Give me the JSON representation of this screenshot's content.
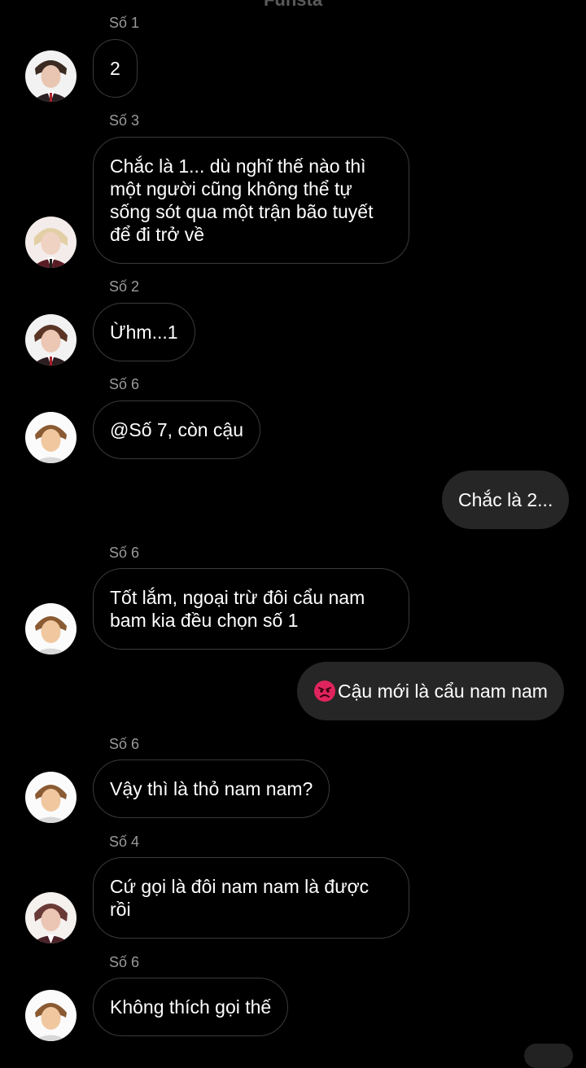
{
  "header": {
    "title": "Funsta"
  },
  "messages": [
    {
      "sender": "Số 1",
      "text": "2"
    },
    {
      "sender": "Số 3",
      "text": "Chắc là 1... dù nghĩ thế nào thì một người cũng không thể tự sống sót qua một trận bão tuyết để đi trở về"
    },
    {
      "sender": "Số 2",
      "text": "Ừhm...1"
    },
    {
      "sender": "Số 6",
      "text": "@Số 7, còn cậu"
    },
    {
      "outgoing": true,
      "text": "Chắc là 2..."
    },
    {
      "sender": "Số 6",
      "text": "Tốt lắm, ngoại trừ đôi cẩu nam bam kia đều chọn số 1"
    },
    {
      "outgoing": true,
      "emoji": "angry-face-icon",
      "text": "Cậu mới là cẩu nam nam"
    },
    {
      "sender": "Số 6",
      "text": "Vậy thì là thỏ nam nam?"
    },
    {
      "sender": "Số 4",
      "text": "Cứ gọi là đôi nam nam là được rồi"
    },
    {
      "sender": "Số 6",
      "text": "Không thích gọi thế"
    }
  ],
  "colors": {
    "background": "#000000",
    "incoming_border": "#3a3a3a",
    "outgoing_bubble": "#262626",
    "sender_label": "#9a9a9a",
    "text": "#ffffff",
    "emoji": "#e0245e"
  }
}
